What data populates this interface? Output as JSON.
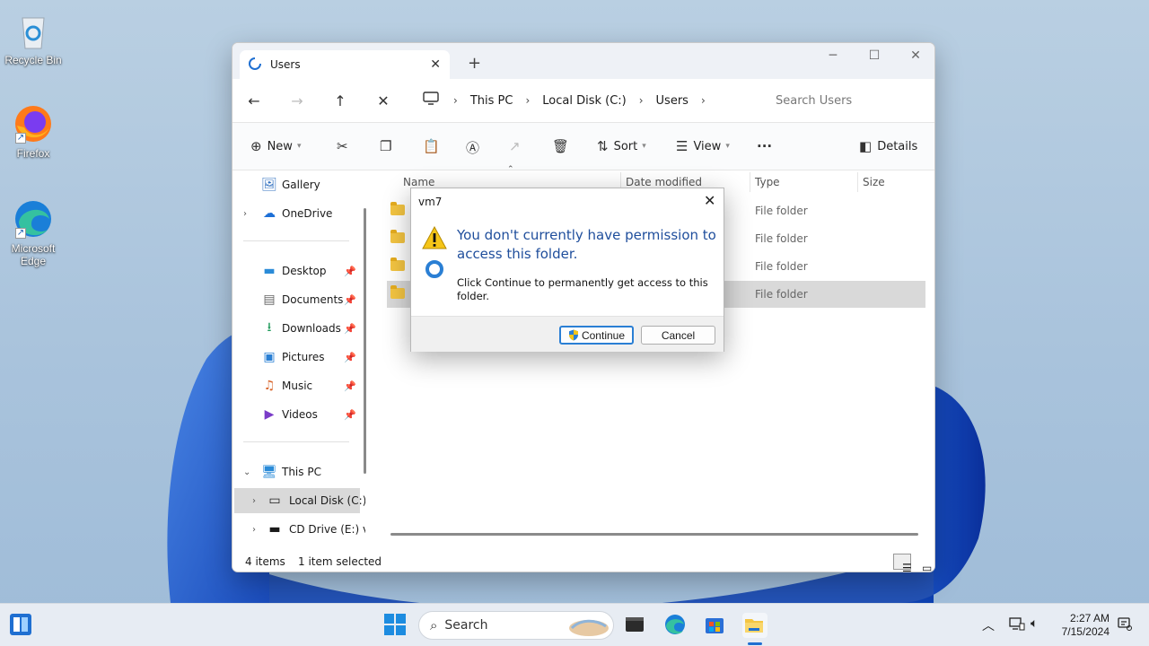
{
  "desktop": {
    "icons": [
      {
        "label": "Recycle Bin"
      },
      {
        "label": "Firefox"
      },
      {
        "label": "Microsoft Edge"
      }
    ]
  },
  "explorer": {
    "tab_title": "Users",
    "breadcrumb": [
      "This PC",
      "Local Disk (C:)",
      "Users"
    ],
    "search_placeholder": "Search Users",
    "toolbar": {
      "new": "New",
      "sort": "Sort",
      "view": "View",
      "details": "Details"
    },
    "nav": {
      "gallery": "Gallery",
      "onedrive": "OneDrive",
      "desktop": "Desktop",
      "documents": "Documents",
      "downloads": "Downloads",
      "pictures": "Pictures",
      "music": "Music",
      "videos": "Videos",
      "this_pc": "This PC",
      "local_disk": "Local Disk (C:)",
      "cd_drive": "CD Drive (E:) v"
    },
    "columns": [
      "Name",
      "Date modified",
      "Type",
      "Size"
    ],
    "rows": [
      {
        "type": "File folder"
      },
      {
        "type": "File folder"
      },
      {
        "type": "File folder"
      },
      {
        "type": "File folder"
      }
    ],
    "status": {
      "count": "4 items",
      "selected": "1 item selected"
    }
  },
  "dialog": {
    "title": "vm7",
    "heading": "You don't currently have permission to access this folder.",
    "body": "Click Continue to permanently get access to this folder.",
    "continue": "Continue",
    "cancel": "Cancel"
  },
  "taskbar": {
    "search": "Search",
    "time": "2:27 AM",
    "date": "7/15/2024"
  },
  "colors": {
    "accent": "#1f6fd1",
    "folder": "#f4c542",
    "dialog_heading": "#1f4e9c"
  }
}
